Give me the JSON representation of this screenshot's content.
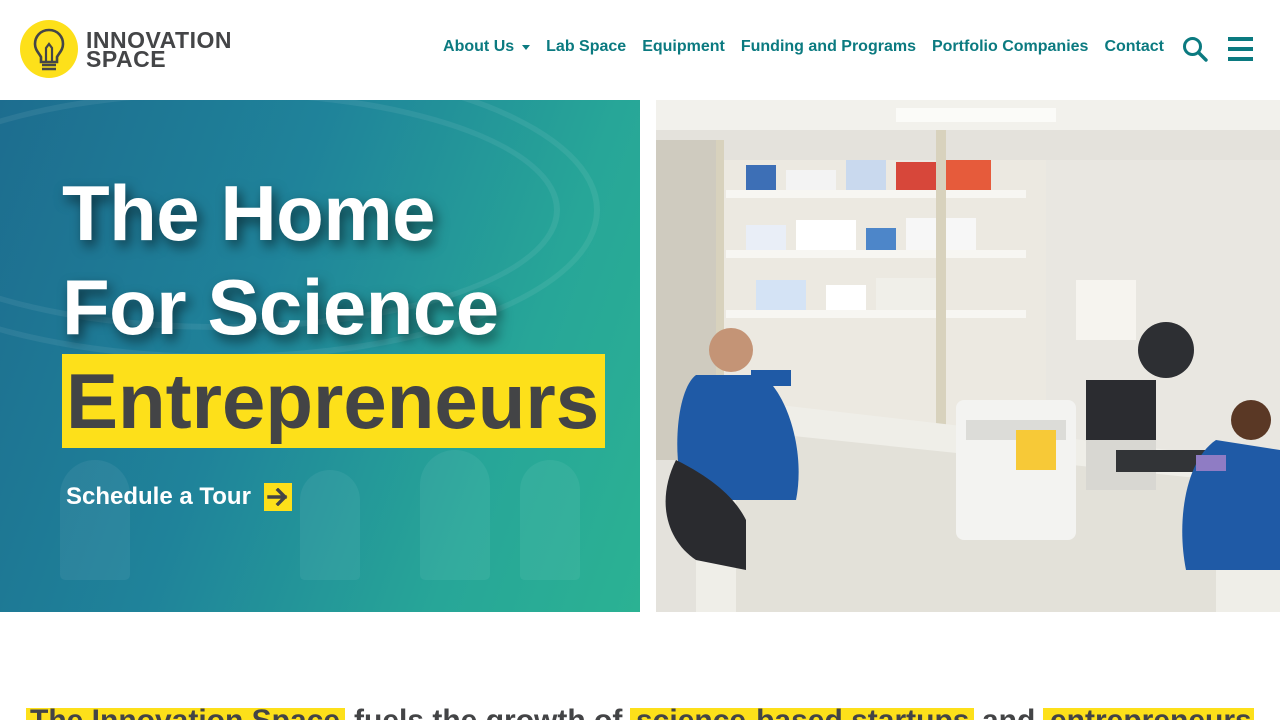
{
  "brand": {
    "logo_line1": "INNOVATION",
    "logo_line2": "SPACE",
    "accent_yellow": "#fde01a",
    "teal": "#0b7a80",
    "dark_text": "#434446"
  },
  "nav": {
    "items": [
      {
        "label": "About Us",
        "has_dropdown": true
      },
      {
        "label": "Lab Space"
      },
      {
        "label": "Equipment"
      },
      {
        "label": "Funding and Programs"
      },
      {
        "label": "Portfolio Companies"
      },
      {
        "label": "Contact"
      }
    ],
    "search_icon": "search-icon",
    "menu_icon": "hamburger-menu-icon"
  },
  "hero": {
    "title_line1": "The Home",
    "title_line2": "For Science",
    "title_highlight": "Entrepreneurs",
    "cta_label": "Schedule a Tour",
    "cta_icon": "arrow-right-icon",
    "image_alt": "Laboratory"
  },
  "intro": {
    "visible_fragment_1": "The Innovation Space",
    "visible_fragment_2": "fuels the growth of",
    "visible_fragment_3": "science-based startups",
    "visible_fragment_4": "and",
    "visible_fragment_5": "entrepreneurs"
  }
}
